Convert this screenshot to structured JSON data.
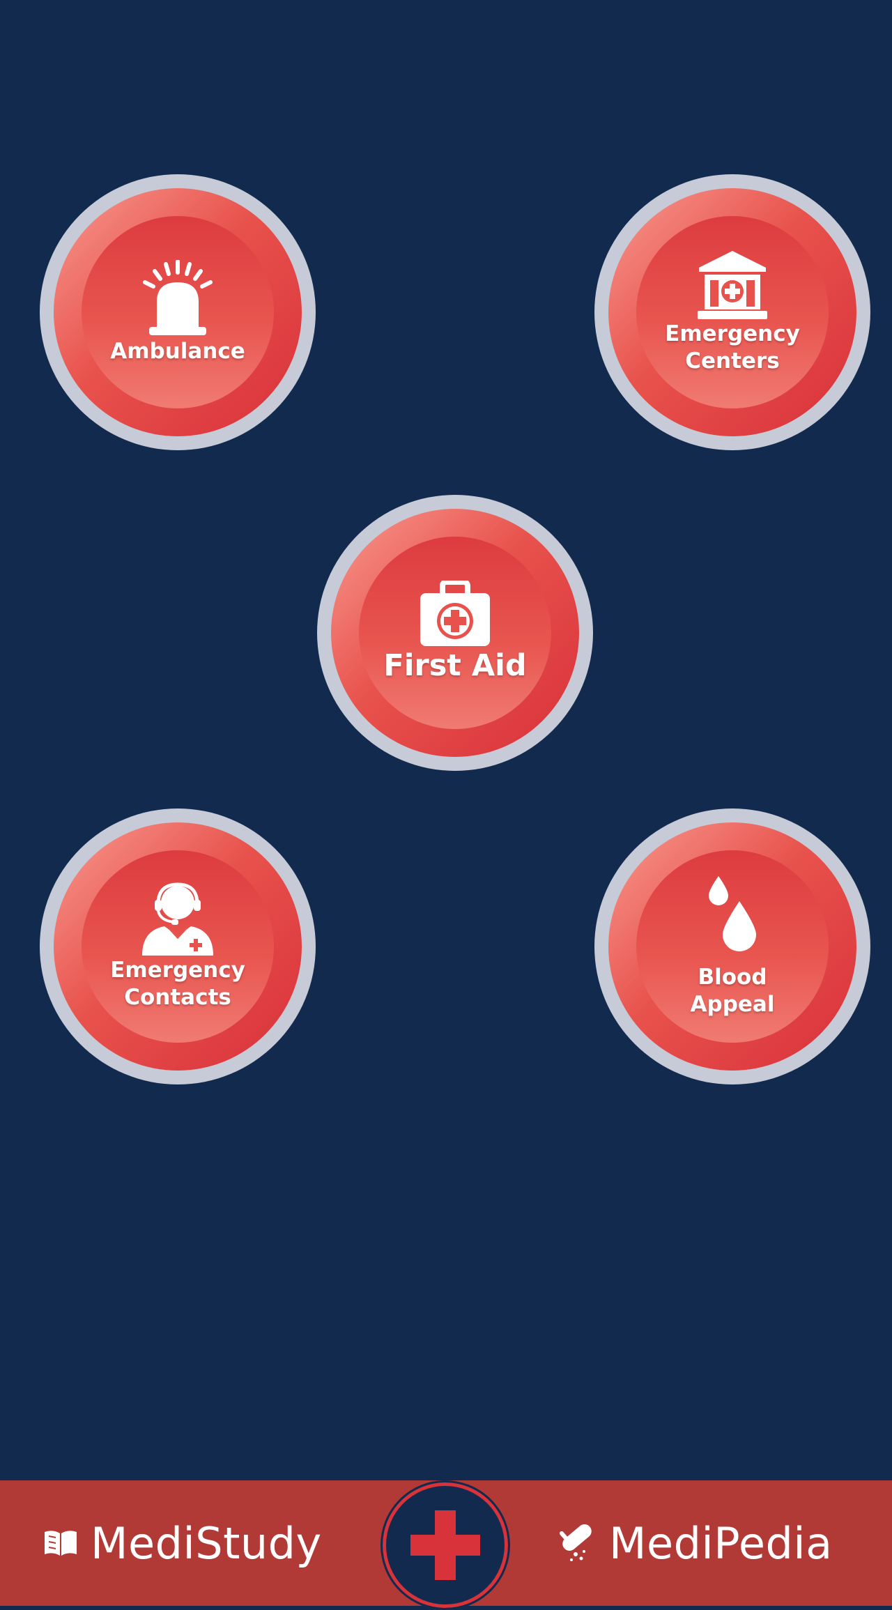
{
  "colors": {
    "background": "#132a4f",
    "button_red": "#e8524c",
    "button_ring": "#c7cbd8",
    "bottom_bar": "#b23a36",
    "label_text": "#ffffff"
  },
  "buttons": {
    "ambulance": {
      "label": "Ambulance",
      "icon": "siren-icon"
    },
    "emergency_centers": {
      "label_line1": "Emergency",
      "label_line2": "Centers",
      "icon": "hospital-building-icon"
    },
    "first_aid": {
      "label": "First Aid",
      "icon": "first-aid-kit-icon"
    },
    "emergency_contacts": {
      "label_line1": "Emergency",
      "label_line2": "Contacts",
      "icon": "doctor-headset-icon"
    },
    "blood_appeal": {
      "label_line1": "Blood",
      "label_line2": "Appeal",
      "icon": "blood-drops-icon"
    }
  },
  "bottom_nav": {
    "medistudy": {
      "label": "MediStudy",
      "icon": "book-icon"
    },
    "center": {
      "icon": "red-cross-icon"
    },
    "medipedia": {
      "label": "MediPedia",
      "icon": "pills-icon"
    }
  }
}
